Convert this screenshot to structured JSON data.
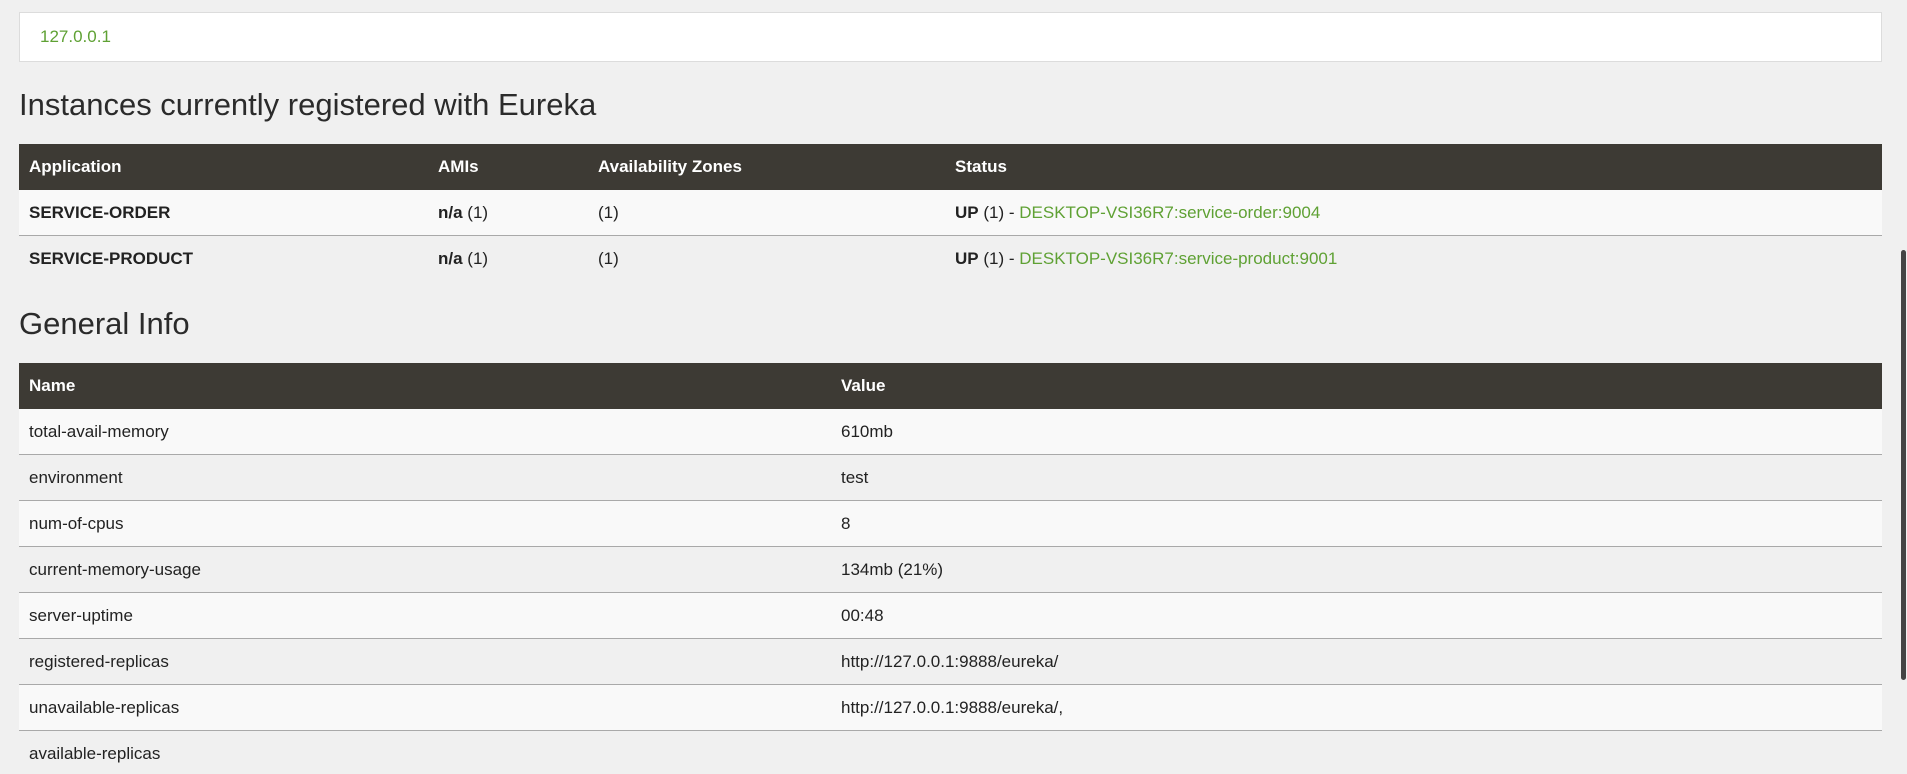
{
  "replica": {
    "link": "127.0.0.1"
  },
  "instances": {
    "title": "Instances currently registered with Eureka",
    "headers": {
      "application": "Application",
      "amis": "AMIs",
      "zones": "Availability Zones",
      "status": "Status"
    },
    "rows": [
      {
        "application": "SERVICE-ORDER",
        "ami_label": "n/a",
        "ami_count": " (1)",
        "zones": "(1)",
        "status_label": "UP",
        "status_count": " (1) - ",
        "instance": "DESKTOP-VSI36R7:service-order:9004"
      },
      {
        "application": "SERVICE-PRODUCT",
        "ami_label": "n/a",
        "ami_count": " (1)",
        "zones": "(1)",
        "status_label": "UP",
        "status_count": " (1) - ",
        "instance": "DESKTOP-VSI36R7:service-product:9001"
      }
    ]
  },
  "general": {
    "title": "General Info",
    "headers": {
      "name": "Name",
      "value": "Value"
    },
    "rows": [
      {
        "name": "total-avail-memory",
        "value": "610mb"
      },
      {
        "name": "environment",
        "value": "test"
      },
      {
        "name": "num-of-cpus",
        "value": "8"
      },
      {
        "name": "current-memory-usage",
        "value": "134mb (21%)"
      },
      {
        "name": "server-uptime",
        "value": "00:48"
      },
      {
        "name": "registered-replicas",
        "value": "http://127.0.0.1:9888/eureka/"
      },
      {
        "name": "unavailable-replicas",
        "value": "http://127.0.0.1:9888/eureka/,"
      },
      {
        "name": "available-replicas",
        "value": ""
      }
    ]
  },
  "colors": {
    "link": "#5fa134",
    "table_header_bg": "#3d3a34",
    "page_bg": "#f0f0f0"
  }
}
